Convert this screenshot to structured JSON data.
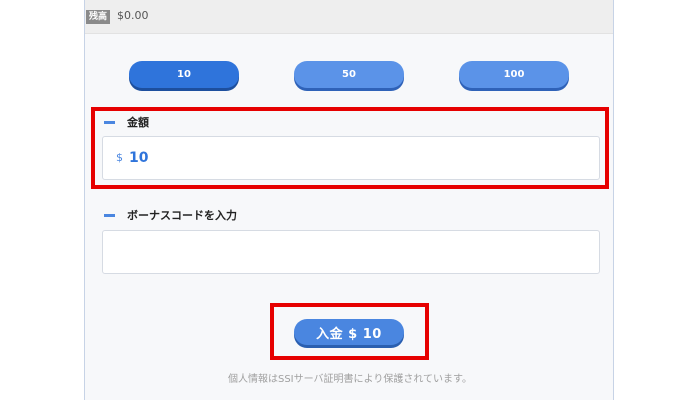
{
  "balance": {
    "badge": "残高",
    "value": "$0.00"
  },
  "presets": [
    {
      "label": "10",
      "active": true
    },
    {
      "label": "50",
      "active": false
    },
    {
      "label": "100",
      "active": false
    }
  ],
  "amount_section": {
    "title": "金額",
    "currency": "$",
    "value": "10"
  },
  "bonus_section": {
    "title": "ボーナスコードを入力",
    "value": ""
  },
  "deposit_button": {
    "label": "入金 $ 10"
  },
  "ssl_note": "個人情報はSSIサーバ証明書により保護されています。",
  "colors": {
    "accent": "#4a86e0",
    "highlight": "#e60000"
  }
}
